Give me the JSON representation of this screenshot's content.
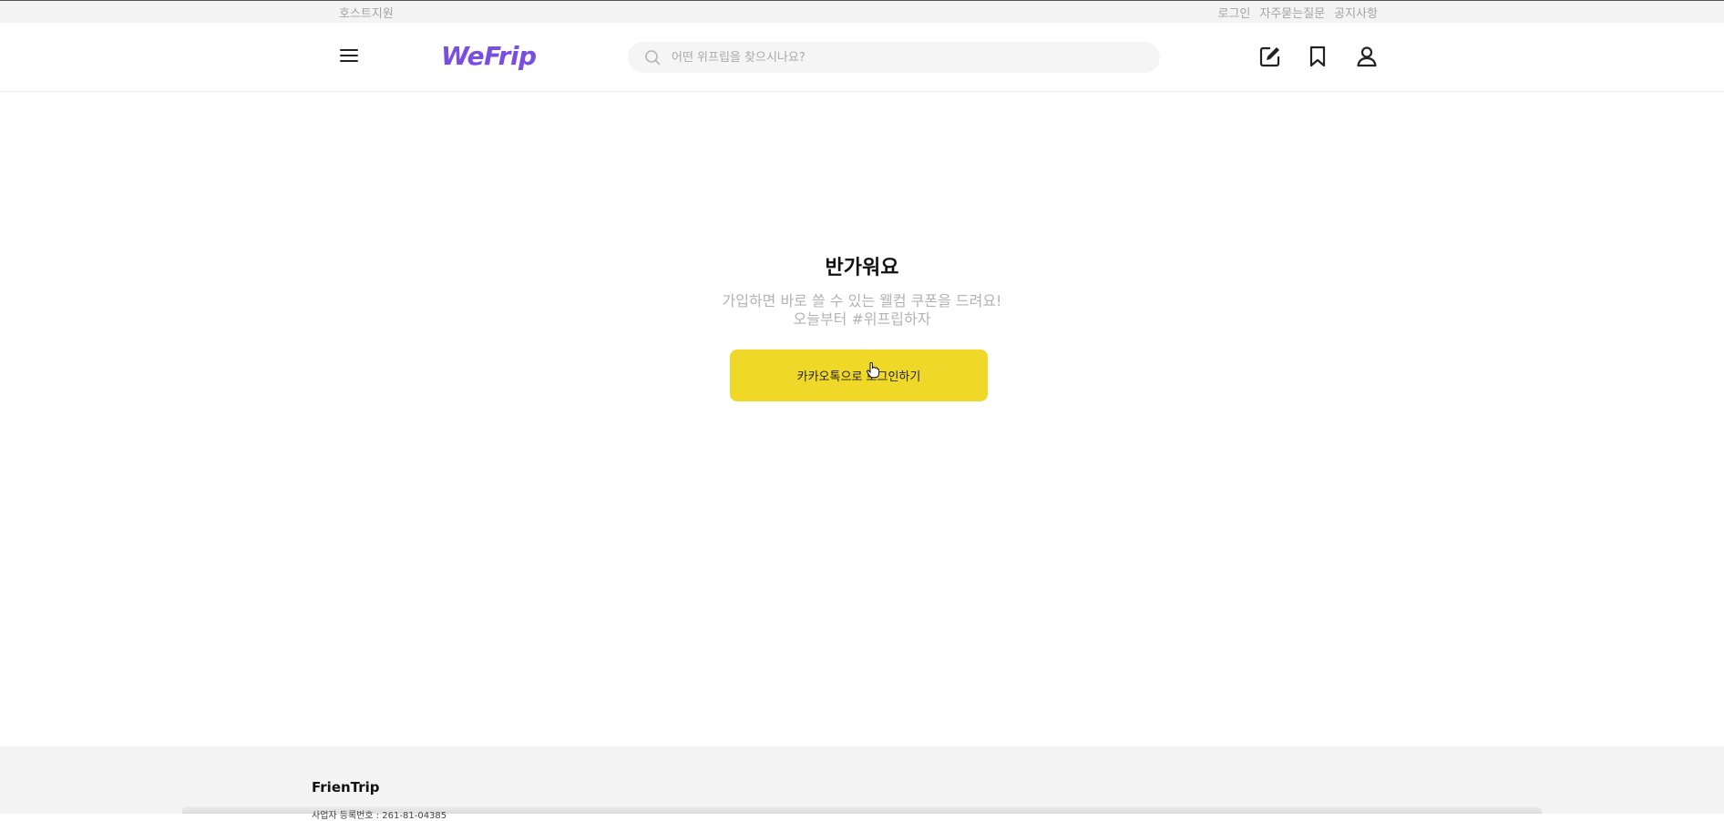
{
  "utility": {
    "host_support": "호스트지원",
    "login": "로그인",
    "faq": "자주묻는질문",
    "notice": "공지사항"
  },
  "header": {
    "logo": "WeFrip",
    "search_placeholder": "어떤 위프립을 찾으시나요?",
    "icons": [
      "menu-icon",
      "search-icon",
      "write-icon",
      "bookmark-icon",
      "user-icon"
    ]
  },
  "main": {
    "title": "반가워요",
    "subtitle_line1": "가입하면 바로 쓸 수 있는 웰컴 쿠폰을 드려요!",
    "subtitle_line2": "오늘부터 #위프립하자",
    "kakao_button": "카카오톡으로 로그인하기"
  },
  "footer": {
    "brand": "FrienTrip",
    "registration": "사업자 등록번호 : 261-81-04385"
  },
  "colors": {
    "brand": "#7a4fe0",
    "kakao": "#f0d828",
    "muted_text": "#b3b3b3"
  }
}
